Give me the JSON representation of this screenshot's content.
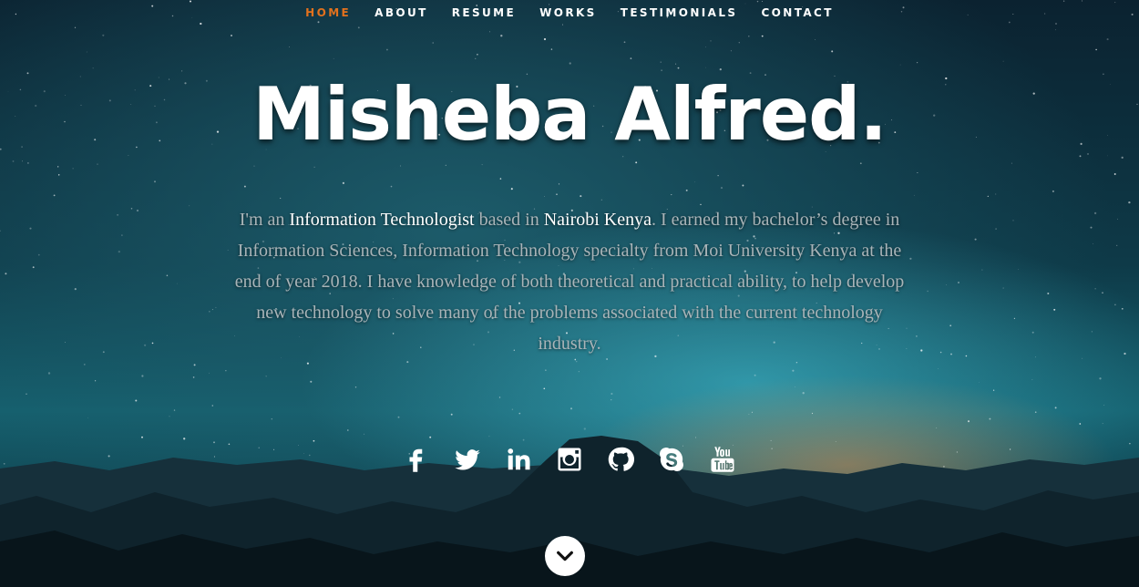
{
  "nav": {
    "items": [
      {
        "label": "HOME",
        "active": true
      },
      {
        "label": "ABOUT",
        "active": false
      },
      {
        "label": "RESUME",
        "active": false
      },
      {
        "label": "WORKS",
        "active": false
      },
      {
        "label": "TESTIMONIALS",
        "active": false
      },
      {
        "label": "CONTACT",
        "active": false
      }
    ],
    "active_color": "#e2711d"
  },
  "hero": {
    "title": "Misheba Alfred.",
    "bio": {
      "part1": "I'm an ",
      "role": "Information Technologist",
      "part2": " based in ",
      "location": "Nairobi Kenya",
      "part3": ". I earned my bachelor’s degree in Information Sciences, Information Technology specialty from Moi University Kenya at the end of year 2018. I have knowledge of both theoretical and practical ability, to help develop new technology to solve many of the problems associated with the current technology industry."
    }
  },
  "social": {
    "icons": [
      "facebook-icon",
      "twitter-icon",
      "linkedin-icon",
      "instagram-icon",
      "github-icon",
      "skype-icon",
      "youtube-icon"
    ]
  },
  "scroll": {
    "icon": "chevron-down-icon"
  }
}
